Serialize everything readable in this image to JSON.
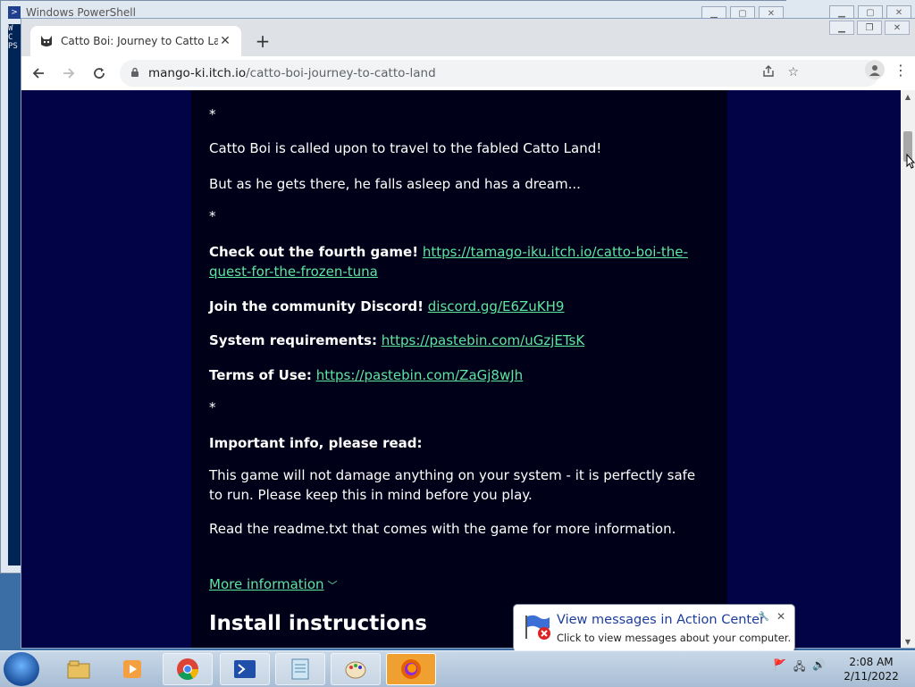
{
  "background_window": {
    "title": "Windows PowerShell",
    "console_lines": [
      "W",
      "C",
      "",
      "PS"
    ]
  },
  "browser": {
    "tab": {
      "title": "Catto Boi: Journey to Catto Land",
      "favicon": "cat-face-icon"
    },
    "url": {
      "host": "mango-ki.itch.io",
      "path": "/catto-boi-journey-to-catto-land"
    }
  },
  "page": {
    "sep1": "*",
    "p_intro": "Catto Boi is called upon to travel to the fabled Catto Land!",
    "p_dream": "But as he gets there, he falls asleep and has a dream...",
    "sep2": "*",
    "fourth_game_label": "Check out the fourth game!",
    "fourth_game_link": "https://tamago-iku.itch.io/catto-boi-the-quest-for-the-frozen-tuna",
    "discord_label": "Join the community Discord!",
    "discord_link": "discord.gg/E6ZuKH9",
    "sysreq_label": "System requirements:",
    "sysreq_link": "https://pastebin.com/uGzjETsK",
    "terms_label": "Terms of Use:",
    "terms_link": "https://pastebin.com/ZaGj8wJh",
    "sep3": "*",
    "important_heading": "Important info, please read:",
    "p_safe": "This game will not damage anything on your system - it is perfectly safe to run. Please keep this in mind before you play.",
    "p_readme": "Read the readme.txt that comes with the game for more information.",
    "more_info": "More information",
    "install_heading": "Install instructions"
  },
  "notification": {
    "title": "View messages in Action Center",
    "text": "Click to view messages about your computer."
  },
  "taskbar": {
    "apps": [
      "start-orb",
      "explorer-icon",
      "media-player-icon",
      "chrome-icon",
      "powershell-icon",
      "notepad-icon",
      "paint-icon",
      "firefox-icon"
    ],
    "time": "2:08 AM",
    "date": "2/11/2022"
  },
  "colors": {
    "page_bg": "#020346",
    "content_bg": "#000019",
    "link": "#5ee5a0"
  }
}
